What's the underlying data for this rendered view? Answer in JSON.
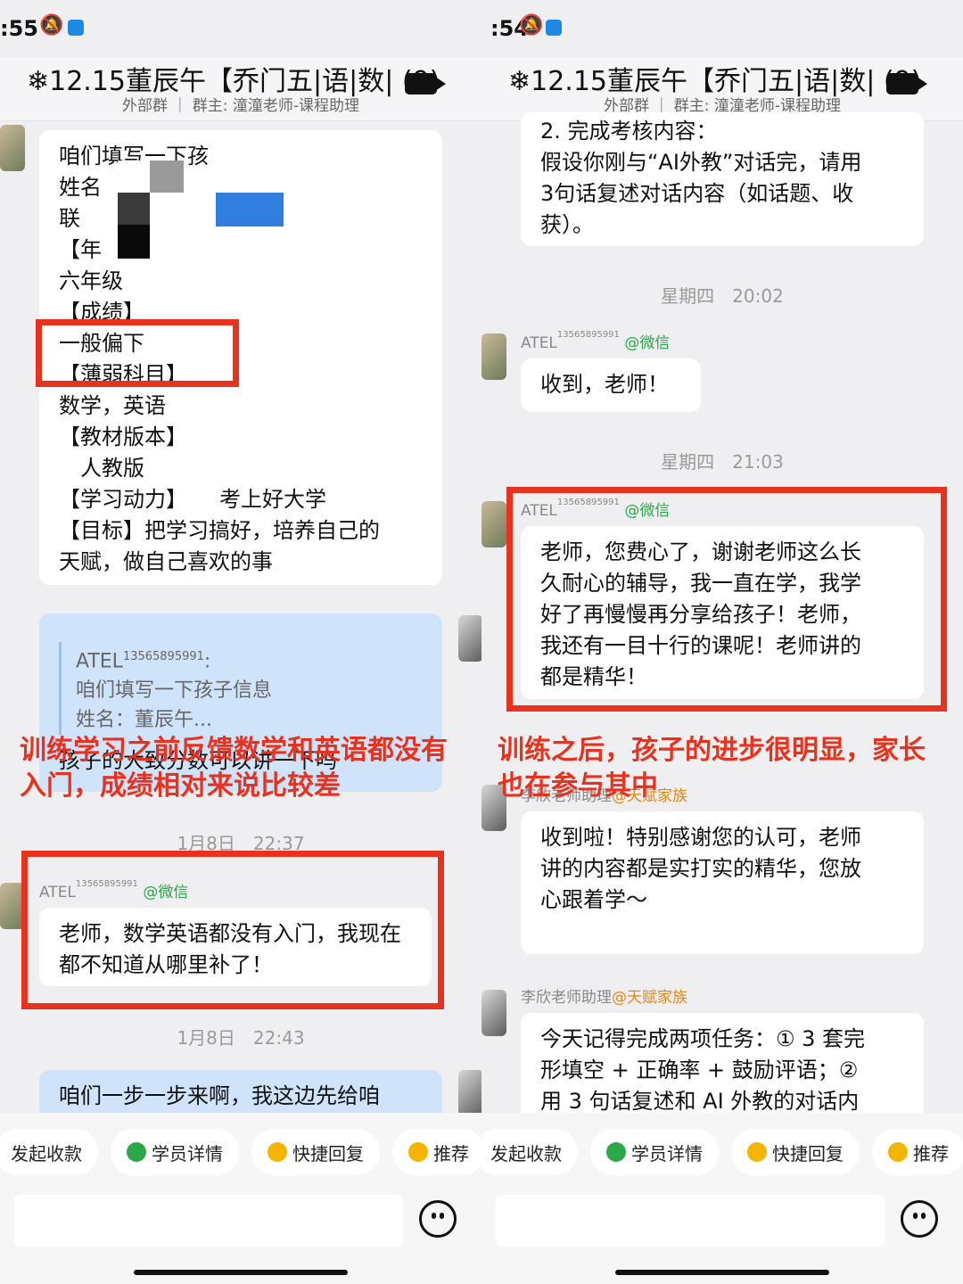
{
  "left": {
    "status_time": ":55",
    "title": "❄12.15董辰午【乔门五|语|数| (9)",
    "subtitle": "外部群 ｜ 群主: 潼潼老师-课程助理",
    "form_lines": [
      "咱们填写一下孩",
      "姓名",
      "联",
      "【年",
      "六年级",
      "【成绩】",
      "一般偏下",
      "【薄弱科目】",
      "数学，英语",
      "【教材版本】",
      "　人教版",
      "【学习动力】　　考上好大学",
      "【目标】把学习搞好，培养自己的",
      "天赋，做自己喜欢的事"
    ],
    "quote_sender": "ATEL",
    "quote_sender_sup": "13565895991",
    "quote_colon": ":",
    "quote_lines": [
      "咱们填写一下孩子信息",
      "姓名：董辰午..."
    ],
    "reply_text": "孩子的大致分数可以讲一下吗",
    "ts1": "1月8日　22:37",
    "msg_sender": "ATEL",
    "msg_sender_sup": "13565895991",
    "msg_tag": "@微信",
    "msg_text": "老师，数学英语都没有入门，我现在都不知道从哪里补了！",
    "ts2": "1月8日　22:43",
    "last_text": "咱们一步一步来啊，我这边先给咱",
    "overlay": [
      "训练学习之前反馈数学和英语都没有",
      "入门，成绩相对来说比较差"
    ],
    "chips": [
      "发起收款",
      "学员详情",
      "快捷回复",
      "推荐"
    ]
  },
  "right": {
    "status_time": ":54",
    "title": "❄12.15董辰午【乔门五|语|数| (9)",
    "subtitle": "外部群 ｜ 群主: 潼潼老师-课程助理",
    "top_lines": [
      "2. 完成考核内容：",
      "假设你刚与“AI外教”对话完，请用",
      "3句话复述对话内容（如话题、收",
      "获）。"
    ],
    "ts1": "星期四　20:02",
    "sender1": "ATEL",
    "sender1_sup": "13565895991",
    "sender1_tag": "@微信",
    "msg1": "收到，老师！",
    "ts2": "星期四　21:03",
    "msg2_lines": [
      "老师，您费心了，谢谢老师这么长",
      "久耐心的辅导，我一直在学，我学",
      "好了再慢慢再分享给孩子！老师，",
      "我还有一目十行的课呢！老师讲的",
      "都是精华！"
    ],
    "sender3": "李欣老师助理",
    "sender3_tag": "@天赋家族",
    "msg3_lines": [
      "收到啦！特别感谢您的认可，老师",
      "讲的内容都是实打实的精华，您放",
      "心跟着学～"
    ],
    "sender4": "李欣老师助理",
    "sender4_tag": "@天赋家族",
    "msg4_lines": [
      "今天记得完成两项任务：① 3 套完",
      "形填空 + 正确率 + 鼓励评语；②",
      "用 3 句话复述和 AI 外教的对话内"
    ],
    "overlay": [
      "训练之后，孩子的进步很明显，家长",
      "也在参与其中"
    ],
    "chips": [
      "发起收款",
      "学员详情",
      "快捷回复",
      "推荐"
    ]
  },
  "colors": {
    "red_box": "#e8321e",
    "tag_green": "#2aa84a",
    "tag_orange": "#e6870f",
    "bubble_blue": "#cfe3fb"
  }
}
